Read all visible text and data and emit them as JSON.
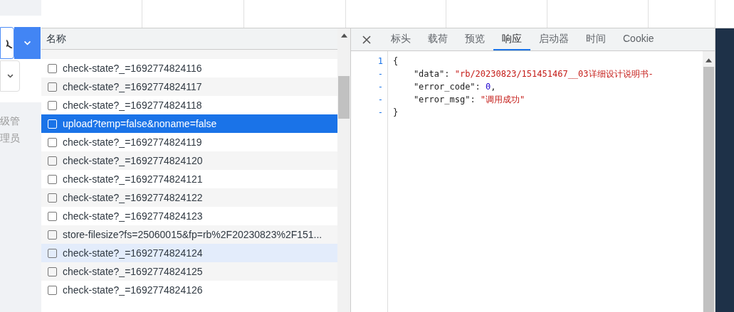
{
  "page": {
    "side_text": [
      "级管",
      "理员"
    ]
  },
  "request_list": {
    "header": "名称",
    "rows": [
      {
        "name": "check-state?_=1692774824116",
        "selected": false,
        "hovered": false
      },
      {
        "name": "check-state?_=1692774824117",
        "selected": false,
        "hovered": false
      },
      {
        "name": "check-state?_=1692774824118",
        "selected": false,
        "hovered": false
      },
      {
        "name": "upload?temp=false&noname=false",
        "selected": true,
        "hovered": false
      },
      {
        "name": "check-state?_=1692774824119",
        "selected": false,
        "hovered": false
      },
      {
        "name": "check-state?_=1692774824120",
        "selected": false,
        "hovered": false
      },
      {
        "name": "check-state?_=1692774824121",
        "selected": false,
        "hovered": false
      },
      {
        "name": "check-state?_=1692774824122",
        "selected": false,
        "hovered": false
      },
      {
        "name": "check-state?_=1692774824123",
        "selected": false,
        "hovered": false
      },
      {
        "name": "store-filesize?fs=25060015&fp=rb%2F20230823%2F151...",
        "selected": false,
        "hovered": false
      },
      {
        "name": "check-state?_=1692774824124",
        "selected": false,
        "hovered": true
      },
      {
        "name": "check-state?_=1692774824125",
        "selected": false,
        "hovered": false
      },
      {
        "name": "check-state?_=1692774824126",
        "selected": false,
        "hovered": false
      }
    ]
  },
  "detail": {
    "tabs": [
      {
        "label": "标头",
        "selected": false
      },
      {
        "label": "载荷",
        "selected": false
      },
      {
        "label": "预览",
        "selected": false
      },
      {
        "label": "响应",
        "selected": true
      },
      {
        "label": "启动器",
        "selected": false
      },
      {
        "label": "时间",
        "selected": false
      },
      {
        "label": "Cookie",
        "selected": false
      }
    ],
    "response_lines": [
      {
        "gutter": "1",
        "tokens": [
          {
            "kind": "punct",
            "text": "{"
          }
        ]
      },
      {
        "gutter": "-",
        "tokens": [
          {
            "kind": "key",
            "text": "    \"data\""
          },
          {
            "kind": "punct",
            "text": ": "
          },
          {
            "kind": "string",
            "text": "\"rb/20230823/151451467__03详细设计说明书-"
          }
        ]
      },
      {
        "gutter": "-",
        "tokens": [
          {
            "kind": "key",
            "text": "    \"error_code\""
          },
          {
            "kind": "punct",
            "text": ": "
          },
          {
            "kind": "number",
            "text": "0"
          },
          {
            "kind": "punct",
            "text": ","
          }
        ]
      },
      {
        "gutter": "-",
        "tokens": [
          {
            "kind": "key",
            "text": "    \"error_msg\""
          },
          {
            "kind": "punct",
            "text": ": "
          },
          {
            "kind": "string",
            "text": "\"调用成功\""
          }
        ]
      },
      {
        "gutter": "-",
        "tokens": [
          {
            "kind": "punct",
            "text": "}"
          }
        ]
      }
    ]
  }
}
